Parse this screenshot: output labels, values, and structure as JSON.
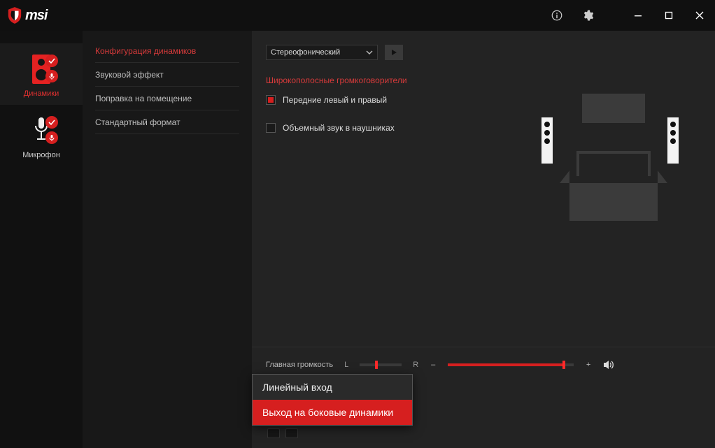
{
  "brand": {
    "name": "msi"
  },
  "devices": {
    "speakers": {
      "label": "Динамики"
    },
    "mic": {
      "label": "Микрофон"
    }
  },
  "nav": {
    "items": [
      {
        "label": "Конфигурация динамиков",
        "active": true
      },
      {
        "label": "Звуковой эффект"
      },
      {
        "label": "Поправка на помещение"
      },
      {
        "label": "Стандартный формат"
      }
    ]
  },
  "config": {
    "mode": "Стереофонический",
    "section_title": "Широкополосные громкоговорители",
    "front_lr": "Передние левый и правый",
    "headphone_surround": "Объемный звук в наушниках"
  },
  "volume": {
    "title": "Главная громкость",
    "L": "L",
    "R": "R",
    "minus": "–",
    "plus": "+",
    "balance_pct": 40,
    "level_pct": 92
  },
  "popup": {
    "items": [
      {
        "label": "Линейный вход"
      },
      {
        "label": "Выход на боковые динамики",
        "selected": true
      }
    ]
  }
}
